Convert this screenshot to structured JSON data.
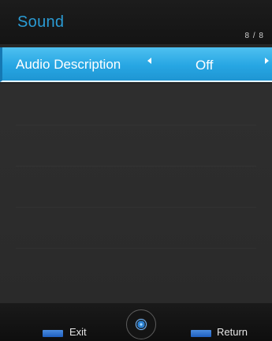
{
  "header": {
    "title": "Sound",
    "page_indicator": "8 / 8"
  },
  "menu": {
    "selected_item": {
      "label": "Audio Description",
      "value": "Off"
    }
  },
  "footer": {
    "exit_key_icon": "exit-key-icon",
    "exit_label": "Exit",
    "navigate_icon": "navigation-pad-icon",
    "return_key_icon": "return-key-icon",
    "return_label": "Return"
  },
  "colors": {
    "title": "#2a9bd4",
    "selection_bar": "#27a6e3",
    "background": "#262626"
  }
}
